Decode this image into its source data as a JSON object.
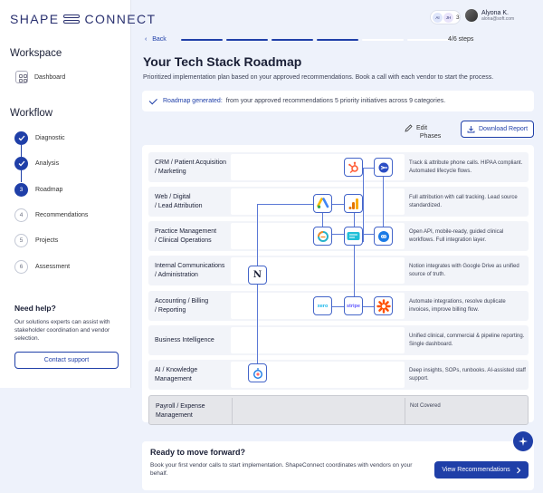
{
  "brand": {
    "left": "SHAPE",
    "right": "CONNECT"
  },
  "sidebar": {
    "workspace_heading": "Workspace",
    "dashboard_label": "Dashboard",
    "workflow_heading": "Workflow",
    "steps": [
      {
        "num": "",
        "label": "Diagnostic",
        "state": "done"
      },
      {
        "num": "",
        "label": "Analysis",
        "state": "done"
      },
      {
        "num": "3",
        "label": "Roadmap",
        "state": "current"
      },
      {
        "num": "4",
        "label": "Recommendations",
        "state": "todo"
      },
      {
        "num": "5",
        "label": "Projects",
        "state": "todo"
      },
      {
        "num": "6",
        "label": "Assessment",
        "state": "todo"
      }
    ],
    "help_title": "Need help?",
    "help_text": "Our solutions experts can assist with stakeholder coordination and vendor selection.",
    "contact_label": "Contact support"
  },
  "topbar": {
    "avatars": [
      "AI",
      "JH"
    ],
    "avatar_count": "3",
    "user_name": "Alyona K.",
    "user_email": "alona@soft.com"
  },
  "header": {
    "back_label": "Back",
    "progress_done": 4,
    "progress_total": 6,
    "steps_label": "4/6 steps",
    "title": "Your Tech Stack Roadmap",
    "subtitle": "Prioritized implementation plan based on your approved recommendations. Book a call with each vendor to start the process.",
    "banner_key": "Roadmap generated:",
    "banner_text": "from your approved recommendations 5 priority initiatives across 9 categories.",
    "edit_label_1": "Edit",
    "edit_label_2": "Phases",
    "download_label": "Download Report"
  },
  "rows": [
    {
      "cat1": "CRM / Patient Acquisition",
      "cat2": "/ Marketing",
      "note": "Track & attribute phone calls. HIPAA compliant. Automated lifecycle flows.",
      "covered": true
    },
    {
      "cat1": "Web / Digital",
      "cat2": "/ Lead Attribution",
      "note": "Full attribution with call tracking. Lead source standardized.",
      "covered": true
    },
    {
      "cat1": "Practice Management",
      "cat2": "/ Clinical Operations",
      "note": "Open API, mobile-ready, guided clinical workflows. Full integration layer.",
      "covered": true
    },
    {
      "cat1": "Internal Communications",
      "cat2": "/ Administration",
      "note": "Notion integrates with Google Drive as unified source of truth.",
      "covered": true
    },
    {
      "cat1": "Accounting / Billing",
      "cat2": "/ Reporting",
      "note": "Automate integrations, resolve duplicate invoices, improve billing flow.",
      "covered": true
    },
    {
      "cat1": "Business Intelligence",
      "cat2": "",
      "note": "Unified clinical, commercial & pipeline reporting. Single dashboard.",
      "covered": true
    },
    {
      "cat1": "AI / Knowledge",
      "cat2": "Management",
      "note": "Deep insights, SOPs, runbooks. AI-assisted staff support.",
      "covered": true
    },
    {
      "cat1": "Payroll / Expense",
      "cat2": "Management",
      "note": "Not Covered",
      "covered": false
    }
  ],
  "vendors": [
    {
      "id": "hubspot-logo-icon",
      "text": ""
    },
    {
      "id": "callrail-logo-icon",
      "text": ""
    },
    {
      "id": "google-ads-logo-icon",
      "text": ""
    },
    {
      "id": "google-analytics-logo-icon",
      "text": ""
    },
    {
      "id": "clinic-app-logo-icon",
      "text": ""
    },
    {
      "id": "practice-mgmt-logo-icon",
      "text": ""
    },
    {
      "id": "loop-logo-icon",
      "text": ""
    },
    {
      "id": "notion-logo-icon",
      "text": "N"
    },
    {
      "id": "xero-logo-icon",
      "text": "xero"
    },
    {
      "id": "stripe-logo-icon",
      "text": "stripe"
    },
    {
      "id": "zapier-logo-icon",
      "text": ""
    },
    {
      "id": "ai-assistant-logo-icon",
      "text": ""
    }
  ],
  "cta": {
    "title": "Ready to move forward?",
    "text": "Book your first vendor calls to start implementation. ShapeConnect coordinates with vendors on your behalf.",
    "button_label": "View Recommendations"
  },
  "colors": {
    "accent": "#1f3fa8",
    "hubspot": "#ff5c35",
    "zapier": "#ff4f00",
    "xero": "#13b5ea",
    "stripe": "#635bff"
  }
}
